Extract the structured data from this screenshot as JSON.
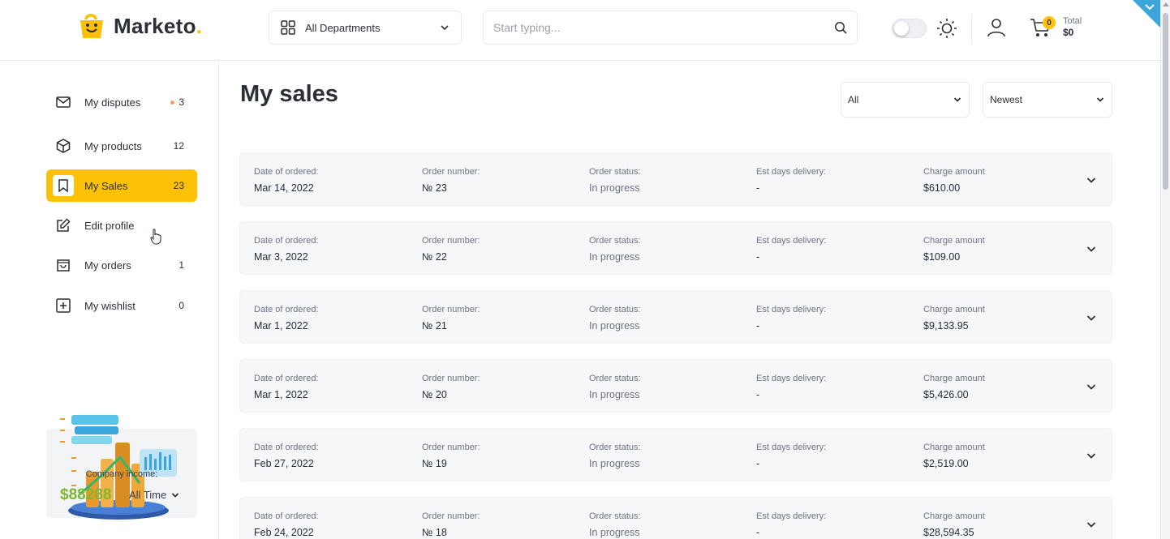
{
  "header": {
    "logo_text": "Marketo",
    "logo_dot": ".",
    "departments_label": "All Departments",
    "search_placeholder": "Start typing...",
    "cart_count": "0",
    "cart_total_label": "Total",
    "cart_total_value": "$0"
  },
  "sidebar": {
    "items": [
      {
        "label": "My disputes",
        "count": "3",
        "icon": "mail-icon",
        "has_dot": true
      },
      {
        "label": "My products",
        "count": "12",
        "icon": "box-icon"
      },
      {
        "label": "My Sales",
        "count": "23",
        "icon": "bookmark-icon",
        "active": true
      },
      {
        "label": "Edit profile",
        "count": "",
        "icon": "edit-icon"
      },
      {
        "label": "My orders",
        "count": "1",
        "icon": "shopping-bag-icon"
      },
      {
        "label": "My wishlist",
        "count": "0",
        "icon": "plus-square-icon"
      }
    ],
    "income": {
      "label": "Company income:",
      "value": "$88288",
      "period": "All Time"
    }
  },
  "main": {
    "title": "My sales",
    "filter_select": "All",
    "sort_select": "Newest",
    "column_labels": {
      "date": "Date of ordered:",
      "number": "Order number:",
      "status": "Order status:",
      "delivery": "Est days delivery:",
      "amount": "Charge amount"
    },
    "orders": [
      {
        "date": "Mar 14, 2022",
        "number": "№ 23",
        "status": "In progress",
        "delivery": "-",
        "amount": "$610.00"
      },
      {
        "date": "Mar 3, 2022",
        "number": "№ 22",
        "status": "In progress",
        "delivery": "-",
        "amount": "$109.00"
      },
      {
        "date": "Mar 1, 2022",
        "number": "№ 21",
        "status": "In progress",
        "delivery": "-",
        "amount": "$9,133.95"
      },
      {
        "date": "Mar 1, 2022",
        "number": "№ 20",
        "status": "In progress",
        "delivery": "-",
        "amount": "$5,426.00"
      },
      {
        "date": "Feb 27, 2022",
        "number": "№ 19",
        "status": "In progress",
        "delivery": "-",
        "amount": "$2,519.00"
      },
      {
        "date": "Feb 24, 2022",
        "number": "№ 18",
        "status": "In progress",
        "delivery": "-",
        "amount": "$28,594.35"
      }
    ]
  },
  "colors": {
    "accent": "#ffc107",
    "income_green": "#7cb82f",
    "corner_blue": "#3aa6dc",
    "row_bg": "#f6f7f9"
  }
}
